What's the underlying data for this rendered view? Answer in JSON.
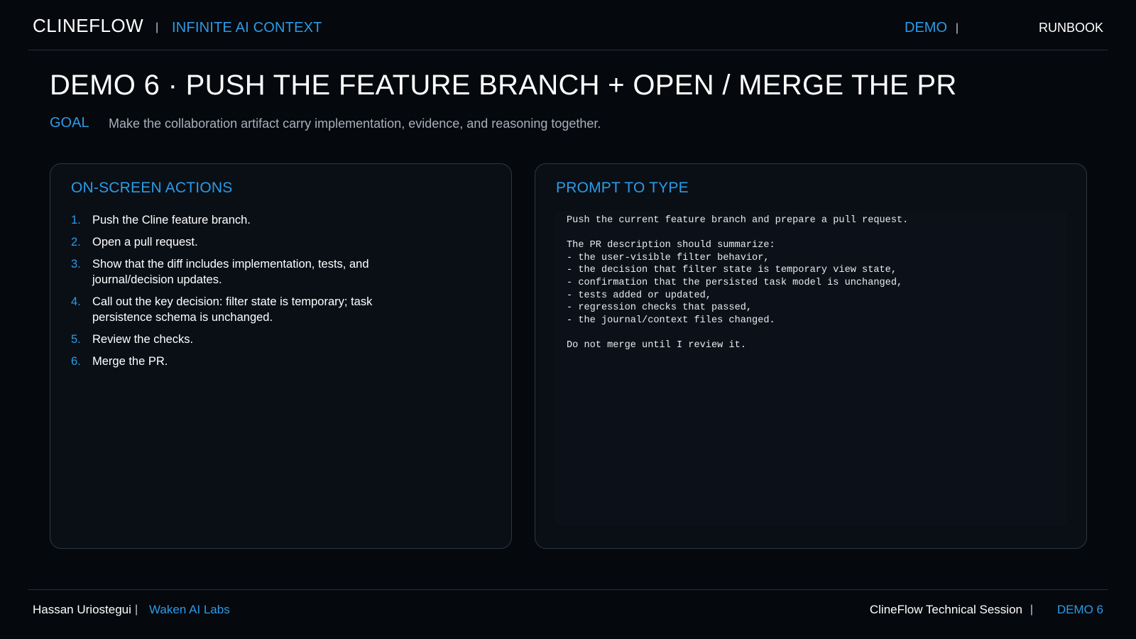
{
  "header": {
    "brand": "CLINEFLOW",
    "separator": "|",
    "tagline": "INFINITE AI CONTEXT",
    "nav_demo": "DEMO",
    "nav_runbook": "RUNBOOK"
  },
  "slide": {
    "title": "DEMO 6 · PUSH THE FEATURE BRANCH + OPEN / MERGE THE PR",
    "goal_label": "GOAL",
    "goal_text": "Make the collaboration artifact carry implementation, evidence, and reasoning together."
  },
  "actions_panel": {
    "heading": "ON-SCREEN ACTIONS",
    "steps": [
      {
        "num": "1.",
        "text": "Push the Cline feature branch."
      },
      {
        "num": "2.",
        "text": "Open a pull request."
      },
      {
        "num": "3.",
        "text": "Show that the diff includes implementation, tests, and journal/decision updates."
      },
      {
        "num": "4.",
        "text": "Call out the key decision: filter state is temporary; task persistence schema is unchanged."
      },
      {
        "num": "5.",
        "text": "Review the checks."
      },
      {
        "num": "6.",
        "text": "Merge the PR."
      }
    ]
  },
  "prompt_panel": {
    "heading": "PROMPT TO TYPE",
    "prompt": "Push the current feature branch and prepare a pull request.\n\nThe PR description should summarize:\n- the user-visible filter behavior,\n- the decision that filter state is temporary view state,\n- confirmation that the persisted task model is unchanged,\n- tests added or updated,\n- regression checks that passed,\n- the journal/context files changed.\n\nDo not merge until I review it."
  },
  "footer": {
    "author": "Hassan Uriostegui",
    "separator": "|",
    "org": "Waken AI Labs",
    "session": "ClineFlow Technical Session",
    "demo": "DEMO 6"
  },
  "colors": {
    "background": "#05080d",
    "accent": "#2c9be6",
    "panel": "#0a0f16",
    "border": "#2f3640"
  }
}
